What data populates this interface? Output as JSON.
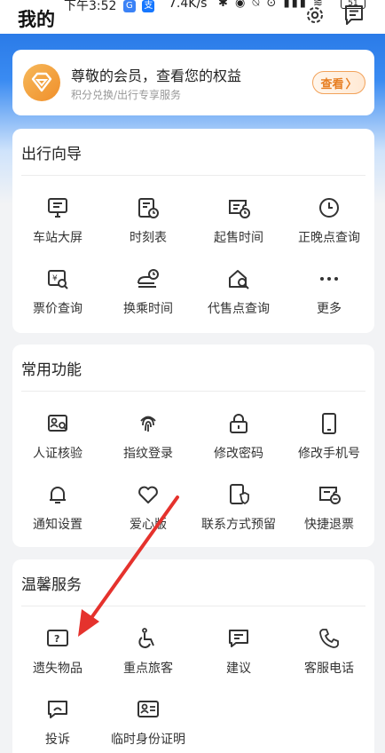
{
  "status_bar": {
    "time": "下午3:52",
    "badge1": "G",
    "badge2": "支",
    "speed": "7.4K/s",
    "battery": "51"
  },
  "header": {
    "title": "我的"
  },
  "member": {
    "title": "尊敬的会员，查看您的权益",
    "subtitle": "积分兑换/出行专享服务",
    "button": "查看"
  },
  "travel_guide": {
    "title": "出行向导",
    "items": [
      {
        "label": "车站大屏",
        "icon": "screen-icon"
      },
      {
        "label": "时刻表",
        "icon": "timetable-icon"
      },
      {
        "label": "起售时间",
        "icon": "ticket-clock-icon"
      },
      {
        "label": "正晚点查询",
        "icon": "clock-icon"
      },
      {
        "label": "票价查询",
        "icon": "price-search-icon"
      },
      {
        "label": "换乘时间",
        "icon": "train-clock-icon"
      },
      {
        "label": "代售点查询",
        "icon": "house-search-icon"
      },
      {
        "label": "更多",
        "icon": "more-icon"
      }
    ]
  },
  "common_functions": {
    "title": "常用功能",
    "items": [
      {
        "label": "人证核验",
        "icon": "id-verify-icon"
      },
      {
        "label": "指纹登录",
        "icon": "fingerprint-icon"
      },
      {
        "label": "修改密码",
        "icon": "lock-icon"
      },
      {
        "label": "修改手机号",
        "icon": "phone-icon"
      },
      {
        "label": "通知设置",
        "icon": "bell-icon"
      },
      {
        "label": "爱心版",
        "icon": "heart-icon"
      },
      {
        "label": "联系方式预留",
        "icon": "phone-shield-icon"
      },
      {
        "label": "快捷退票",
        "icon": "ticket-refund-icon"
      }
    ]
  },
  "warm_services": {
    "title": "温馨服务",
    "items": [
      {
        "label": "遗失物品",
        "icon": "lost-item-icon"
      },
      {
        "label": "重点旅客",
        "icon": "wheelchair-icon"
      },
      {
        "label": "建议",
        "icon": "suggestion-icon"
      },
      {
        "label": "客服电话",
        "icon": "call-icon"
      },
      {
        "label": "投诉",
        "icon": "complaint-icon"
      },
      {
        "label": "临时身份证明",
        "icon": "id-card-icon"
      }
    ]
  },
  "colors": {
    "brand_blue": "#2f7be8",
    "accent_orange": "#e77e22",
    "annotation_red": "#e5322d"
  }
}
